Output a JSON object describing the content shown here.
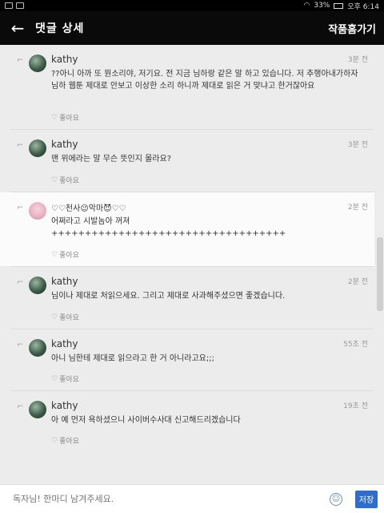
{
  "statusbar": {
    "battery": "33%",
    "time": "오후 6:14"
  },
  "appbar": {
    "back_icon": "back-arrow-icon",
    "title": "댓글 상세",
    "action": "작품홈가기"
  },
  "comments": [
    {
      "name": "kathy",
      "time": "3분 전",
      "text": "??아니 아까 또 뭔소리야, 저기요. 전 지금 님하랑 같은 말 하고 있습니다. 저 추행아내가하자님하 웹툰 제대로 안보고 이상한 소리 하니까 제대로 읽은 거 맞냐고 한거잖아요",
      "like": "좋아요"
    },
    {
      "name": "kathy",
      "time": "3분 전",
      "text": "맨 위에라는 말 무슨 뜻인지 몰라요?",
      "like": "좋아요"
    },
    {
      "name": "♡♡천사😉악마😈♡♡",
      "time": "2분 전",
      "text": "어쩌라고 시발놈아 꺼져\n+++++++++++++++++++++++++++++++++++",
      "like": "좋아요"
    },
    {
      "name": "kathy",
      "time": "2분 전",
      "text": "님이나 제대로 처읽으세요. 그리고 제대로 사과해주셨으면 좋겠습니다.",
      "like": "좋아요"
    },
    {
      "name": "kathy",
      "time": "55초 전",
      "text": "아니 님한테 제대로 읽으라고 한 거 아니라고요;;;",
      "like": "좋아요"
    },
    {
      "name": "kathy",
      "time": "19초 전",
      "text": "아 예 먼저 욕하셨으니 사이버수사대 신고해드리겠습니다",
      "like": "좋아요"
    }
  ],
  "input": {
    "placeholder": "독자님! 한마디 남겨주세요.",
    "save_label": "저장"
  }
}
